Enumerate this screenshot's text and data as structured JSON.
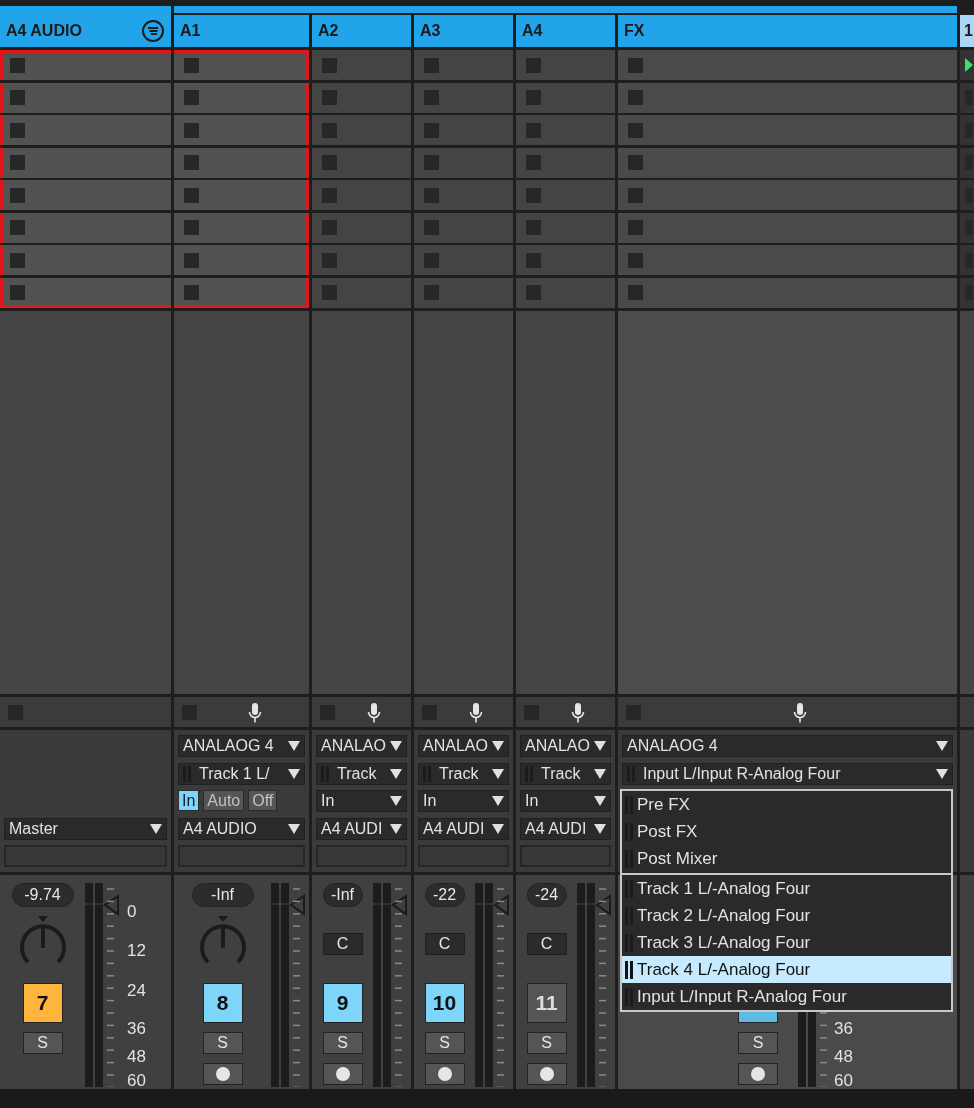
{
  "group_track": {
    "kind": "group",
    "name": "A4 AUDIO",
    "slots": [
      {
        "kind": "empty",
        "selected": true
      },
      {
        "kind": "empty",
        "selected": true
      },
      {
        "kind": "empty",
        "selected": true
      },
      {
        "kind": "empty",
        "selected": true
      },
      {
        "kind": "empty",
        "selected": true
      },
      {
        "kind": "empty",
        "selected": true
      },
      {
        "kind": "empty",
        "selected": true
      },
      {
        "kind": "empty",
        "selected": true
      }
    ],
    "io": {
      "output": "Master"
    },
    "mixer": {
      "volume": "-9.74",
      "pan": {
        "kind": "knob"
      },
      "number": "7",
      "active": true,
      "color": "#ffb43e",
      "solo": "S",
      "scale": [
        "0",
        "12",
        "24",
        "36",
        "48",
        "60"
      ]
    }
  },
  "tracks": [
    {
      "kind": "audio",
      "name": "A1",
      "slots": [
        {
          "kind": "empty",
          "selected": true
        },
        {
          "kind": "empty",
          "selected": true
        },
        {
          "kind": "empty",
          "selected": true
        },
        {
          "kind": "empty",
          "selected": true
        },
        {
          "kind": "empty",
          "selected": true
        },
        {
          "kind": "empty",
          "selected": true
        },
        {
          "kind": "empty",
          "selected": true
        },
        {
          "kind": "empty",
          "selected": true
        }
      ],
      "io": {
        "input_type": "ANALAOG 4",
        "input_channel": "Track 1 L/",
        "monitor": {
          "kind": "buttons",
          "options": [
            {
              "label": "In",
              "selected": true
            },
            {
              "label": "Auto",
              "selected": false
            },
            {
              "label": "Off",
              "selected": false
            }
          ]
        },
        "output": "A4 AUDIO"
      },
      "mixer": {
        "volume": "-Inf",
        "pan": {
          "kind": "knob"
        },
        "number": "8",
        "active": true,
        "color": "#7dd6fa",
        "solo": "S",
        "armed": false
      }
    },
    {
      "kind": "audio",
      "name": "A2",
      "slots": [
        {
          "kind": "empty",
          "selected": false
        },
        {
          "kind": "empty",
          "selected": false
        },
        {
          "kind": "empty",
          "selected": false
        },
        {
          "kind": "empty",
          "selected": false
        },
        {
          "kind": "empty",
          "selected": false
        },
        {
          "kind": "empty",
          "selected": false
        },
        {
          "kind": "empty",
          "selected": false
        },
        {
          "kind": "empty",
          "selected": false
        }
      ],
      "io": {
        "input_type": "ANALAO",
        "input_channel": "Track",
        "monitor": {
          "kind": "dropdown",
          "value": "In"
        },
        "output": "A4 AUDI"
      },
      "mixer": {
        "volume": "-Inf",
        "pan": {
          "kind": "center",
          "label": "C"
        },
        "number": "9",
        "active": true,
        "color": "#7dd6fa",
        "solo": "S",
        "armed": false
      }
    },
    {
      "kind": "audio",
      "name": "A3",
      "slots": [
        {
          "kind": "empty",
          "selected": false
        },
        {
          "kind": "empty",
          "selected": false
        },
        {
          "kind": "empty",
          "selected": false
        },
        {
          "kind": "empty",
          "selected": false
        },
        {
          "kind": "empty",
          "selected": false
        },
        {
          "kind": "empty",
          "selected": false
        },
        {
          "kind": "empty",
          "selected": false
        },
        {
          "kind": "empty",
          "selected": false
        }
      ],
      "io": {
        "input_type": "ANALAO",
        "input_channel": "Track",
        "monitor": {
          "kind": "dropdown",
          "value": "In"
        },
        "output": "A4 AUDI"
      },
      "mixer": {
        "volume": "-22",
        "pan": {
          "kind": "center",
          "label": "C"
        },
        "number": "10",
        "active": true,
        "color": "#7dd6fa",
        "solo": "S",
        "armed": false
      }
    },
    {
      "kind": "audio",
      "name": "A4",
      "slots": [
        {
          "kind": "empty",
          "selected": false
        },
        {
          "kind": "empty",
          "selected": false
        },
        {
          "kind": "empty",
          "selected": false
        },
        {
          "kind": "empty",
          "selected": false
        },
        {
          "kind": "empty",
          "selected": false
        },
        {
          "kind": "empty",
          "selected": false
        },
        {
          "kind": "empty",
          "selected": false
        },
        {
          "kind": "empty",
          "selected": false
        }
      ],
      "io": {
        "input_type": "ANALAO",
        "input_channel": "Track",
        "monitor": {
          "kind": "dropdown",
          "value": "In"
        },
        "output": "A4 AUDI"
      },
      "mixer": {
        "volume": "-24",
        "pan": {
          "kind": "center",
          "label": "C"
        },
        "number": "11",
        "active": false,
        "solo": "S",
        "armed": false
      }
    },
    {
      "kind": "fx",
      "name": "FX",
      "slots": [
        {
          "kind": "empty",
          "selected": false
        },
        {
          "kind": "empty",
          "selected": false
        },
        {
          "kind": "empty",
          "selected": false
        },
        {
          "kind": "empty",
          "selected": false
        },
        {
          "kind": "empty",
          "selected": false
        },
        {
          "kind": "empty",
          "selected": false
        },
        {
          "kind": "empty",
          "selected": false
        },
        {
          "kind": "empty",
          "selected": false
        }
      ],
      "io": {
        "input_type": "ANALAOG 4",
        "input_channel": "Input L/Input R-Analog Four",
        "menu": {
          "sections": [
            {
              "items": [
                {
                  "label": "Pre FX",
                  "selected": false
                },
                {
                  "label": "Post FX",
                  "selected": false
                },
                {
                  "label": "Post Mixer",
                  "selected": false
                }
              ]
            },
            {
              "items": [
                {
                  "label": "Track 1 L/-Analog Four",
                  "selected": false
                },
                {
                  "label": "Track 2 L/-Analog Four",
                  "selected": false
                },
                {
                  "label": "Track 3 L/-Analog Four",
                  "selected": false
                },
                {
                  "label": "Track 4 L/-Analog Four",
                  "selected": true
                },
                {
                  "label": "Input L/Input R-Analog Four",
                  "selected": false
                }
              ]
            }
          ]
        }
      },
      "mixer": {
        "active": true,
        "color": "#5dbbe3",
        "solo": "S",
        "armed": false,
        "scale": [
          "36",
          "48",
          "60"
        ]
      }
    }
  ],
  "next_track": {
    "name": "1",
    "slots": [
      {
        "kind": "clip"
      },
      {
        "kind": "empty"
      },
      {
        "kind": "empty"
      },
      {
        "kind": "empty"
      },
      {
        "kind": "empty"
      },
      {
        "kind": "empty"
      },
      {
        "kind": "empty"
      },
      {
        "kind": "empty"
      }
    ]
  }
}
